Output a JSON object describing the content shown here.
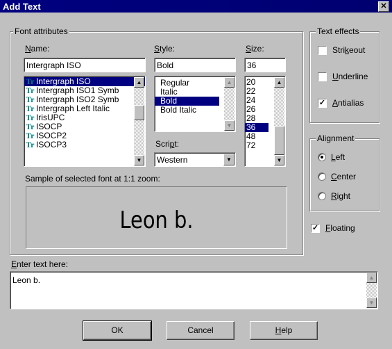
{
  "window": {
    "title": "Add Text",
    "close_symbol": "✕"
  },
  "font_attributes": {
    "legend": "Font attributes",
    "name_label": "Name:",
    "name_value": "Intergraph ISO",
    "fonts": [
      "Intergraph ISO",
      "Intergraph ISO1 Symb",
      "Intergraph ISO2 Symb",
      "Intergraph Left Italic",
      "IrisUPC",
      "ISOCP",
      "ISOCP2",
      "ISOCP3"
    ],
    "font_selected_index": 0,
    "style_label": "Style:",
    "style_value": "Bold",
    "styles": [
      "Regular",
      "Italic",
      "Bold",
      "Bold Italic"
    ],
    "style_selected_index": 2,
    "size_label": "Size:",
    "size_value": "36",
    "sizes": [
      "20",
      "22",
      "24",
      "26",
      "28",
      "36",
      "48",
      "72"
    ],
    "size_selected_index": 5,
    "script_label": "Script:",
    "script_value": "Western",
    "sample_label": "Sample of selected font at 1:1 zoom:",
    "sample_text": "Leon b."
  },
  "text_effects": {
    "legend": "Text effects",
    "strikeout": {
      "label": "Strikeout",
      "checked": false
    },
    "underline": {
      "label": "Underline",
      "checked": false
    },
    "antialias": {
      "label": "Antialias",
      "checked": true
    }
  },
  "alignment": {
    "legend": "Alignment",
    "left": "Left",
    "center": "Center",
    "right": "Right",
    "selected": "Left"
  },
  "floating": {
    "label": "Floating",
    "checked": true
  },
  "enter_text": {
    "label": "Enter text here:",
    "value": "Leon b."
  },
  "buttons": {
    "ok": "OK",
    "cancel": "Cancel",
    "help": "Help"
  },
  "icons": {
    "font": "truetype-font-icon",
    "scroll_up": "▲",
    "scroll_down": "▼",
    "check": "✓"
  }
}
